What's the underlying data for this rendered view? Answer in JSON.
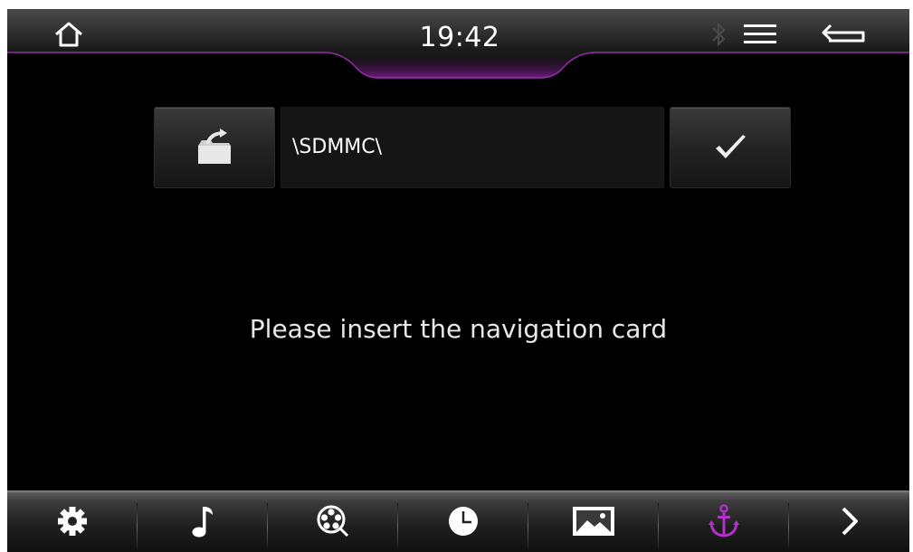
{
  "status_bar": {
    "time": "19:42",
    "icons": [
      "home-icon",
      "bluetooth-icon",
      "menu-icon",
      "back-icon"
    ]
  },
  "path_bar": {
    "current_path": "\\SDMMC\\",
    "open_folder_icon": "open-folder-icon",
    "confirm_icon": "checkmark-icon"
  },
  "message": "Please insert the navigation card",
  "bottom_nav": {
    "items": [
      {
        "icon": "settings-gear-icon"
      },
      {
        "icon": "music-note-icon"
      },
      {
        "icon": "video-reel-icon"
      },
      {
        "icon": "clock-icon"
      },
      {
        "icon": "picture-icon"
      },
      {
        "icon": "navigation-anchor-icon",
        "active": true
      },
      {
        "icon": "next-arrow-icon"
      }
    ]
  },
  "colors": {
    "accent": "#b030c8",
    "background": "#000000",
    "text": "#ffffff"
  }
}
